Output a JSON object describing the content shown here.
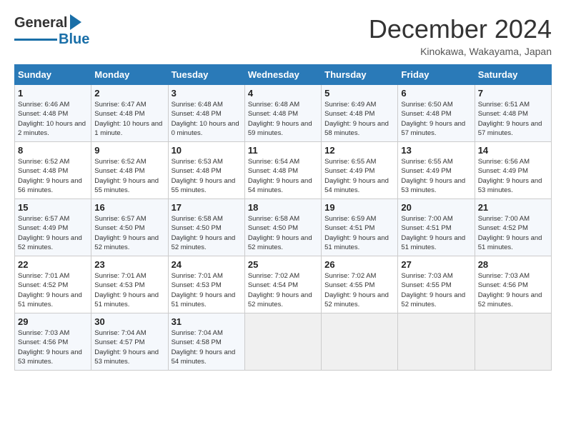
{
  "header": {
    "logo_general": "General",
    "logo_blue": "Blue",
    "month_title": "December 2024",
    "location": "Kinokawa, Wakayama, Japan"
  },
  "days_of_week": [
    "Sunday",
    "Monday",
    "Tuesday",
    "Wednesday",
    "Thursday",
    "Friday",
    "Saturday"
  ],
  "weeks": [
    [
      {
        "day": "1",
        "sunrise": "Sunrise: 6:46 AM",
        "sunset": "Sunset: 4:48 PM",
        "daylight": "Daylight: 10 hours and 2 minutes."
      },
      {
        "day": "2",
        "sunrise": "Sunrise: 6:47 AM",
        "sunset": "Sunset: 4:48 PM",
        "daylight": "Daylight: 10 hours and 1 minute."
      },
      {
        "day": "3",
        "sunrise": "Sunrise: 6:48 AM",
        "sunset": "Sunset: 4:48 PM",
        "daylight": "Daylight: 10 hours and 0 minutes."
      },
      {
        "day": "4",
        "sunrise": "Sunrise: 6:48 AM",
        "sunset": "Sunset: 4:48 PM",
        "daylight": "Daylight: 9 hours and 59 minutes."
      },
      {
        "day": "5",
        "sunrise": "Sunrise: 6:49 AM",
        "sunset": "Sunset: 4:48 PM",
        "daylight": "Daylight: 9 hours and 58 minutes."
      },
      {
        "day": "6",
        "sunrise": "Sunrise: 6:50 AM",
        "sunset": "Sunset: 4:48 PM",
        "daylight": "Daylight: 9 hours and 57 minutes."
      },
      {
        "day": "7",
        "sunrise": "Sunrise: 6:51 AM",
        "sunset": "Sunset: 4:48 PM",
        "daylight": "Daylight: 9 hours and 57 minutes."
      }
    ],
    [
      {
        "day": "8",
        "sunrise": "Sunrise: 6:52 AM",
        "sunset": "Sunset: 4:48 PM",
        "daylight": "Daylight: 9 hours and 56 minutes."
      },
      {
        "day": "9",
        "sunrise": "Sunrise: 6:52 AM",
        "sunset": "Sunset: 4:48 PM",
        "daylight": "Daylight: 9 hours and 55 minutes."
      },
      {
        "day": "10",
        "sunrise": "Sunrise: 6:53 AM",
        "sunset": "Sunset: 4:48 PM",
        "daylight": "Daylight: 9 hours and 55 minutes."
      },
      {
        "day": "11",
        "sunrise": "Sunrise: 6:54 AM",
        "sunset": "Sunset: 4:48 PM",
        "daylight": "Daylight: 9 hours and 54 minutes."
      },
      {
        "day": "12",
        "sunrise": "Sunrise: 6:55 AM",
        "sunset": "Sunset: 4:49 PM",
        "daylight": "Daylight: 9 hours and 54 minutes."
      },
      {
        "day": "13",
        "sunrise": "Sunrise: 6:55 AM",
        "sunset": "Sunset: 4:49 PM",
        "daylight": "Daylight: 9 hours and 53 minutes."
      },
      {
        "day": "14",
        "sunrise": "Sunrise: 6:56 AM",
        "sunset": "Sunset: 4:49 PM",
        "daylight": "Daylight: 9 hours and 53 minutes."
      }
    ],
    [
      {
        "day": "15",
        "sunrise": "Sunrise: 6:57 AM",
        "sunset": "Sunset: 4:49 PM",
        "daylight": "Daylight: 9 hours and 52 minutes."
      },
      {
        "day": "16",
        "sunrise": "Sunrise: 6:57 AM",
        "sunset": "Sunset: 4:50 PM",
        "daylight": "Daylight: 9 hours and 52 minutes."
      },
      {
        "day": "17",
        "sunrise": "Sunrise: 6:58 AM",
        "sunset": "Sunset: 4:50 PM",
        "daylight": "Daylight: 9 hours and 52 minutes."
      },
      {
        "day": "18",
        "sunrise": "Sunrise: 6:58 AM",
        "sunset": "Sunset: 4:50 PM",
        "daylight": "Daylight: 9 hours and 52 minutes."
      },
      {
        "day": "19",
        "sunrise": "Sunrise: 6:59 AM",
        "sunset": "Sunset: 4:51 PM",
        "daylight": "Daylight: 9 hours and 51 minutes."
      },
      {
        "day": "20",
        "sunrise": "Sunrise: 7:00 AM",
        "sunset": "Sunset: 4:51 PM",
        "daylight": "Daylight: 9 hours and 51 minutes."
      },
      {
        "day": "21",
        "sunrise": "Sunrise: 7:00 AM",
        "sunset": "Sunset: 4:52 PM",
        "daylight": "Daylight: 9 hours and 51 minutes."
      }
    ],
    [
      {
        "day": "22",
        "sunrise": "Sunrise: 7:01 AM",
        "sunset": "Sunset: 4:52 PM",
        "daylight": "Daylight: 9 hours and 51 minutes."
      },
      {
        "day": "23",
        "sunrise": "Sunrise: 7:01 AM",
        "sunset": "Sunset: 4:53 PM",
        "daylight": "Daylight: 9 hours and 51 minutes."
      },
      {
        "day": "24",
        "sunrise": "Sunrise: 7:01 AM",
        "sunset": "Sunset: 4:53 PM",
        "daylight": "Daylight: 9 hours and 51 minutes."
      },
      {
        "day": "25",
        "sunrise": "Sunrise: 7:02 AM",
        "sunset": "Sunset: 4:54 PM",
        "daylight": "Daylight: 9 hours and 52 minutes."
      },
      {
        "day": "26",
        "sunrise": "Sunrise: 7:02 AM",
        "sunset": "Sunset: 4:55 PM",
        "daylight": "Daylight: 9 hours and 52 minutes."
      },
      {
        "day": "27",
        "sunrise": "Sunrise: 7:03 AM",
        "sunset": "Sunset: 4:55 PM",
        "daylight": "Daylight: 9 hours and 52 minutes."
      },
      {
        "day": "28",
        "sunrise": "Sunrise: 7:03 AM",
        "sunset": "Sunset: 4:56 PM",
        "daylight": "Daylight: 9 hours and 52 minutes."
      }
    ],
    [
      {
        "day": "29",
        "sunrise": "Sunrise: 7:03 AM",
        "sunset": "Sunset: 4:56 PM",
        "daylight": "Daylight: 9 hours and 53 minutes."
      },
      {
        "day": "30",
        "sunrise": "Sunrise: 7:04 AM",
        "sunset": "Sunset: 4:57 PM",
        "daylight": "Daylight: 9 hours and 53 minutes."
      },
      {
        "day": "31",
        "sunrise": "Sunrise: 7:04 AM",
        "sunset": "Sunset: 4:58 PM",
        "daylight": "Daylight: 9 hours and 54 minutes."
      },
      null,
      null,
      null,
      null
    ]
  ]
}
